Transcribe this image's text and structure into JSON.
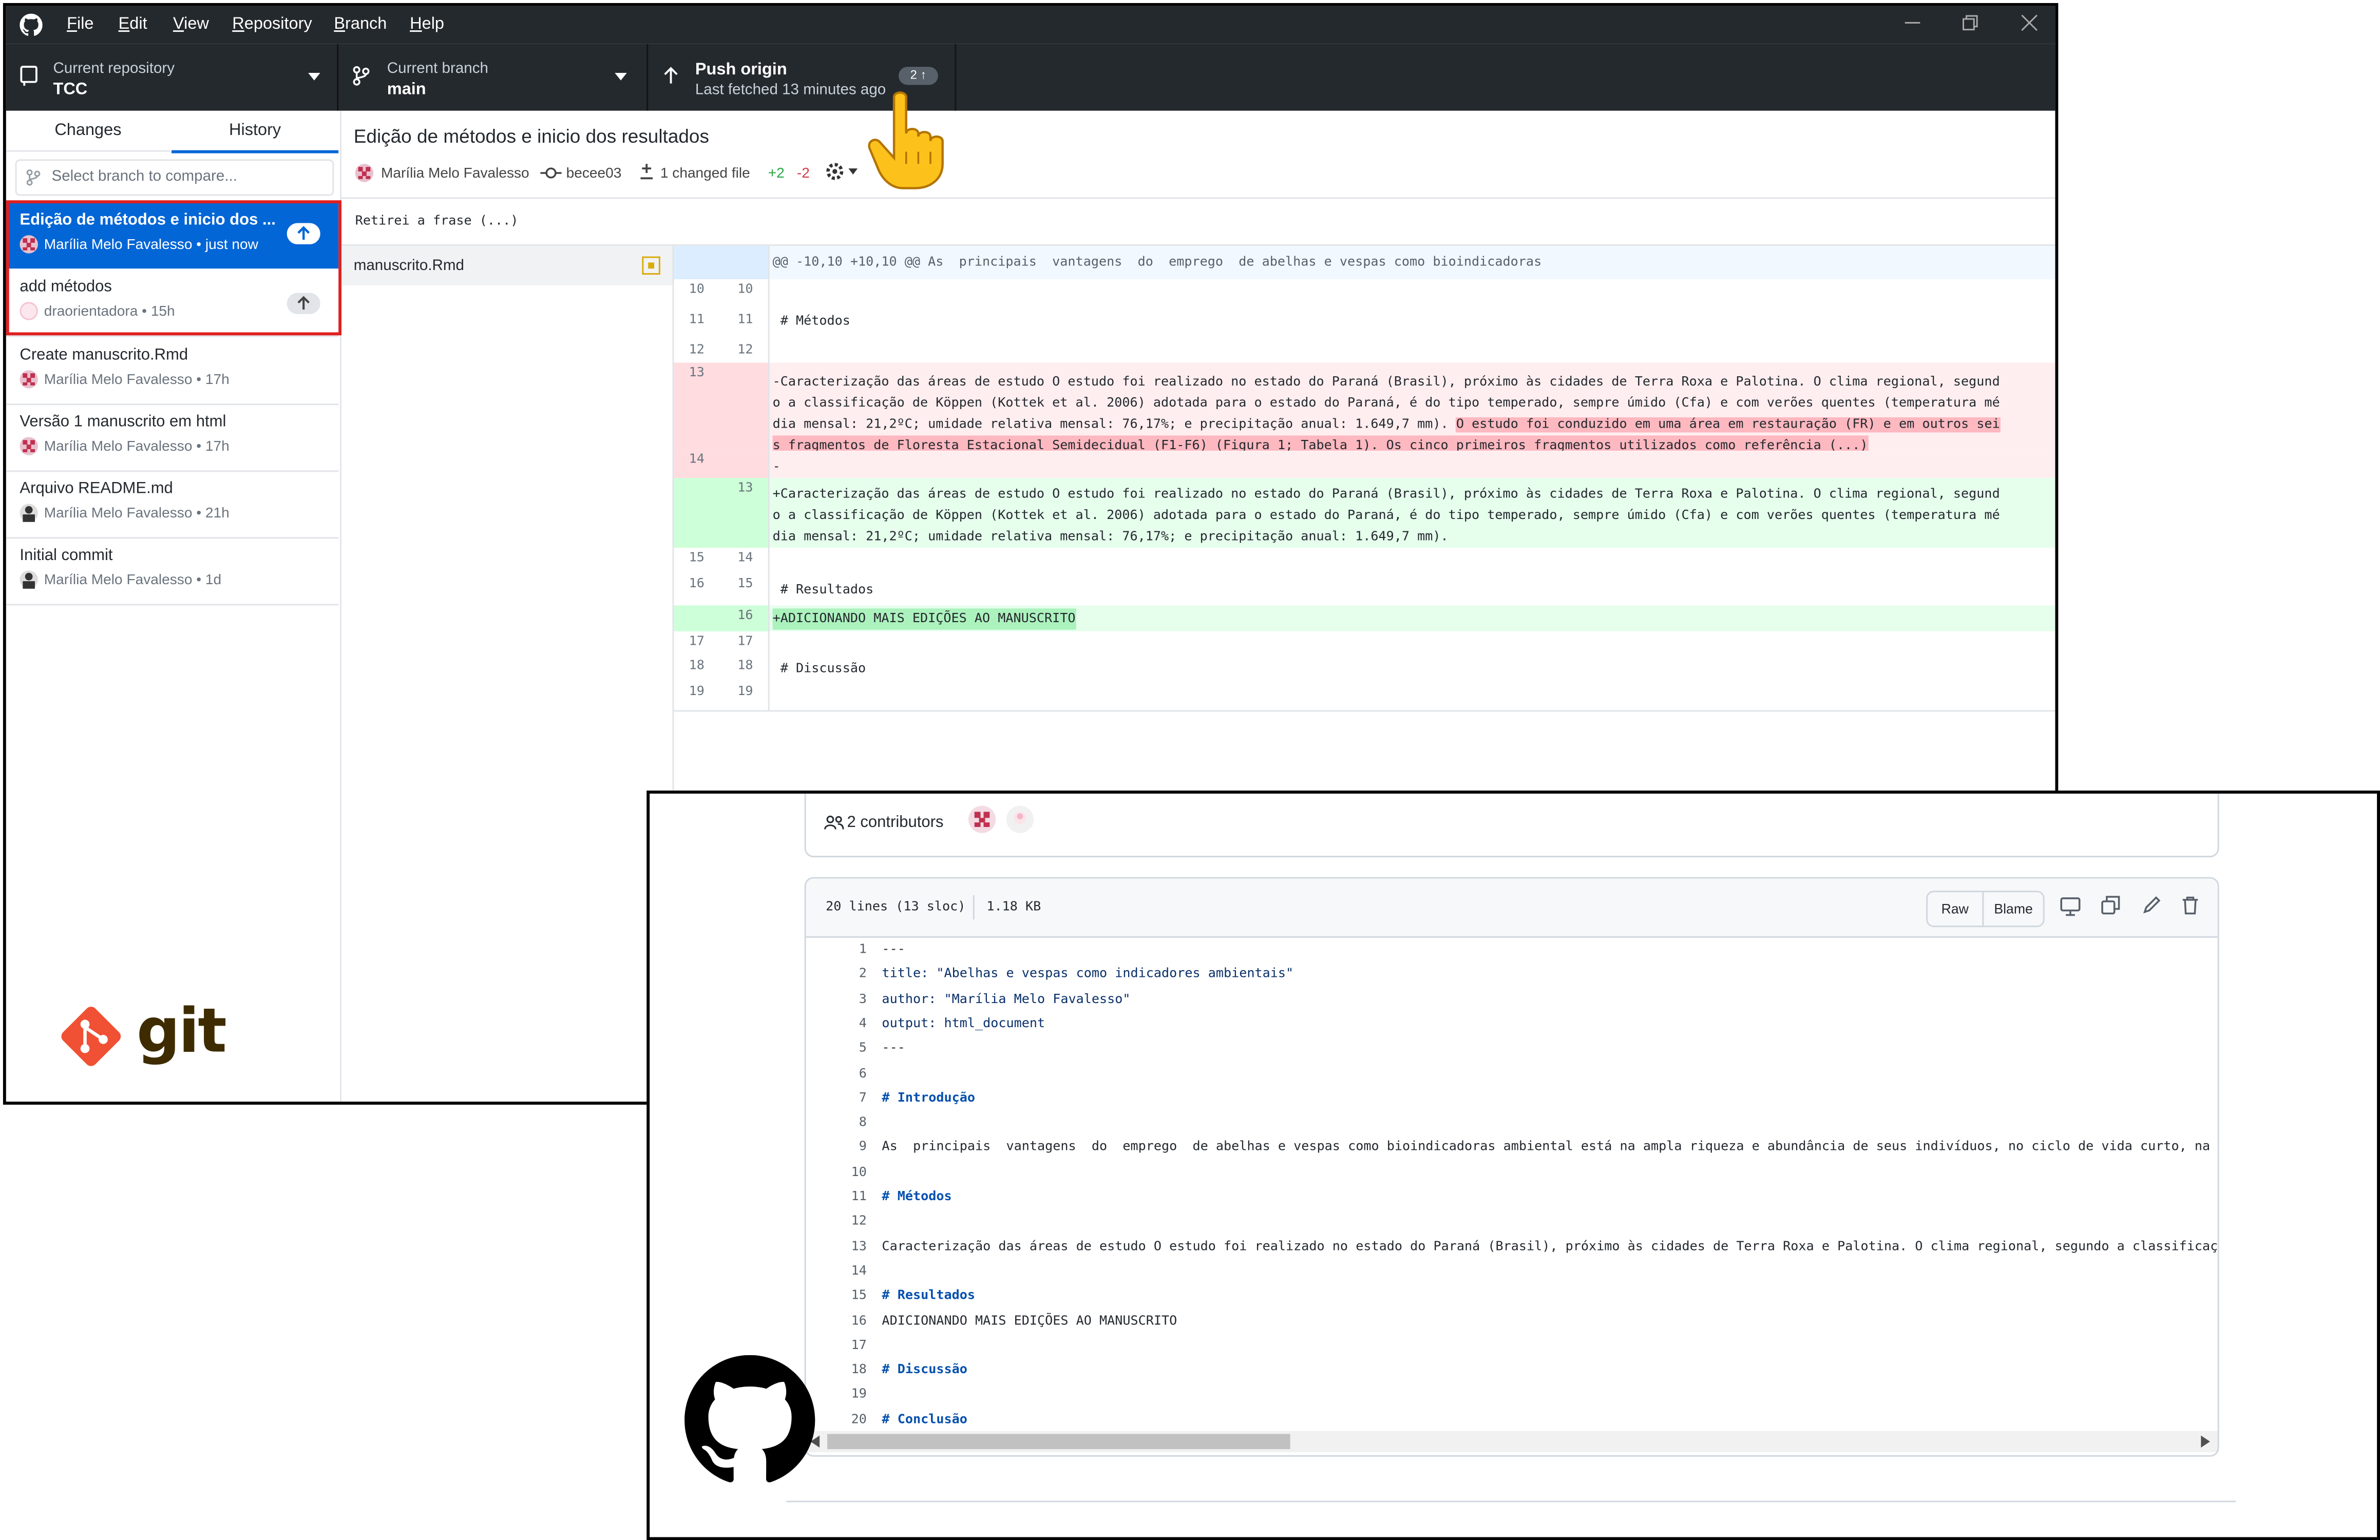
{
  "desktop": {
    "menu": [
      "File",
      "Edit",
      "View",
      "Repository",
      "Branch",
      "Help"
    ],
    "toolbar": {
      "repo_label": "Current repository",
      "repo_value": "TCC",
      "branch_label": "Current branch",
      "branch_value": "main",
      "push_label": "Push origin",
      "push_sub": "Last fetched 13 minutes ago",
      "push_count": "2"
    },
    "tabs": {
      "changes": "Changes",
      "history": "History"
    },
    "branch_compare_placeholder": "Select branch to compare...",
    "commits": [
      {
        "title": "Edição de métodos e inicio dos ...",
        "meta": "Marília Melo Favalesso • just now"
      },
      {
        "title": "add métodos",
        "meta": "draorientadora • 15h"
      },
      {
        "title": "Create manuscrito.Rmd",
        "meta": "Marília Melo Favalesso • 17h"
      },
      {
        "title": "Versão 1 manuscrito em html",
        "meta": "Marília Melo Favalesso • 17h"
      },
      {
        "title": "Arquivo README.md",
        "meta": "Marília Melo Favalesso • 21h"
      },
      {
        "title": "Initial commit",
        "meta": "Marília Melo Favalesso • 1d"
      }
    ],
    "git_logo_text": "git",
    "commit_detail": {
      "title": "Edição de métodos e inicio dos resultados",
      "author": "Marília Melo Favalesso",
      "sha": "becee03",
      "changed": "1 changed file",
      "additions": "+2",
      "deletions": "-2",
      "message": "Retirei a frase (...)"
    },
    "file_name": "manuscrito.Rmd",
    "diff": {
      "hunk": "@@ -10,10 +10,10 @@ As  principais  vantagens  do  emprego  de abelhas e vespas como bioindicadoras",
      "ctx1": {
        "old": "10",
        "new": "10",
        "text": ""
      },
      "ctx2": {
        "old": "11",
        "new": "11",
        "text": " # Métodos"
      },
      "ctx3": {
        "old": "12",
        "new": "12",
        "text": ""
      },
      "del1": {
        "old": "13",
        "new": "",
        "l1": "-Caracterização das áreas de estudo O estudo foi realizado no estado do Paraná (Brasil), próximo às cidades de Terra Roxa e Palotina. O clima regional, segund",
        "l2": "o a classificação de Köppen (Kottek et al. 2006) adotada para o estado do Paraná, é do tipo temperado, sempre úmido (Cfa) e com verões quentes (temperatura mé",
        "l3a": "dia mensal: 21,2ºC; umidade relativa mensal: 76,17%; e precipitação anual: 1.649,7 mm). ",
        "l3b": "O estudo foi conduzido em uma área em restauração (FR) e em outros sei",
        "l4": "s fragmentos de Floresta Estacional Semidecidual (F1-F6) (Figura 1; Tabela 1). Os cinco primeiros fragmentos utilizados como referência (...)"
      },
      "del2": {
        "old": "14",
        "new": "",
        "text": "-"
      },
      "add1": {
        "old": "",
        "new": "13",
        "l1": "+Caracterização das áreas de estudo O estudo foi realizado no estado do Paraná (Brasil), próximo às cidades de Terra Roxa e Palotina. O clima regional, segund",
        "l2": "o a classificação de Köppen (Kottek et al. 2006) adotada para o estado do Paraná, é do tipo temperado, sempre úmido (Cfa) e com verões quentes (temperatura mé",
        "l3": "dia mensal: 21,2ºC; umidade relativa mensal: 76,17%; e precipitação anual: 1.649,7 mm)."
      },
      "ctx4": {
        "old": "15",
        "new": "14",
        "text": ""
      },
      "ctx5": {
        "old": "16",
        "new": "15",
        "text": " # Resultados"
      },
      "add2": {
        "old": "",
        "new": "16",
        "text": "+ADICIONANDO MAIS EDIÇÕES AO MANUSCRITO"
      },
      "ctx6": {
        "old": "17",
        "new": "17",
        "text": ""
      },
      "ctx7": {
        "old": "18",
        "new": "18",
        "text": " # Discussão"
      },
      "ctx8": {
        "old": "19",
        "new": "19",
        "text": ""
      }
    }
  },
  "web": {
    "contributors": "2 contributors",
    "file_info_lines": "20 lines (13 sloc)",
    "file_info_size": "1.18 KB",
    "raw_label": "Raw",
    "blame_label": "Blame",
    "lines": [
      {
        "n": "1",
        "t": "---",
        "h": false
      },
      {
        "n": "2",
        "t": "title: \"Abelhas e vespas como indicadores ambientais\"",
        "h": false
      },
      {
        "n": "3",
        "t": "author: \"Marília Melo Favalesso\"",
        "h": false
      },
      {
        "n": "4",
        "t": "output: html_document",
        "h": false
      },
      {
        "n": "5",
        "t": "---",
        "h": false
      },
      {
        "n": "6",
        "t": "",
        "h": false
      },
      {
        "n": "7",
        "t": "# Introdução",
        "h": true
      },
      {
        "n": "8",
        "t": "",
        "h": false
      },
      {
        "n": "9",
        "t": "As  principais  vantagens  do  emprego  de abelhas e vespas como bioindicadoras ambiental está na ampla riqueza e abundância de seus indivíduos, no ciclo de vida curto, na fác",
        "h": false
      },
      {
        "n": "10",
        "t": "",
        "h": false
      },
      {
        "n": "11",
        "t": "# Métodos",
        "h": true
      },
      {
        "n": "12",
        "t": "",
        "h": false
      },
      {
        "n": "13",
        "t": "Caracterização das áreas de estudo O estudo foi realizado no estado do Paraná (Brasil), próximo às cidades de Terra Roxa e Palotina. O clima regional, segundo a classificação",
        "h": false
      },
      {
        "n": "14",
        "t": "",
        "h": false
      },
      {
        "n": "15",
        "t": "# Resultados",
        "h": true
      },
      {
        "n": "16",
        "t": "ADICIONANDO MAIS EDIÇÕES AO MANUSCRITO",
        "h": false
      },
      {
        "n": "17",
        "t": "",
        "h": false
      },
      {
        "n": "18",
        "t": "# Discussão",
        "h": true
      },
      {
        "n": "19",
        "t": "",
        "h": false
      },
      {
        "n": "20",
        "t": "# Conclusão",
        "h": true
      }
    ]
  },
  "colors": {
    "dark_bar": "#24292e",
    "selected_blue": "#0366d6",
    "highlight_red": "#e02020",
    "diff_del_bg": "#ffdce0",
    "diff_add_bg": "#cdffd8",
    "git_orange": "#f05033",
    "git_text": "#3e2c00"
  }
}
